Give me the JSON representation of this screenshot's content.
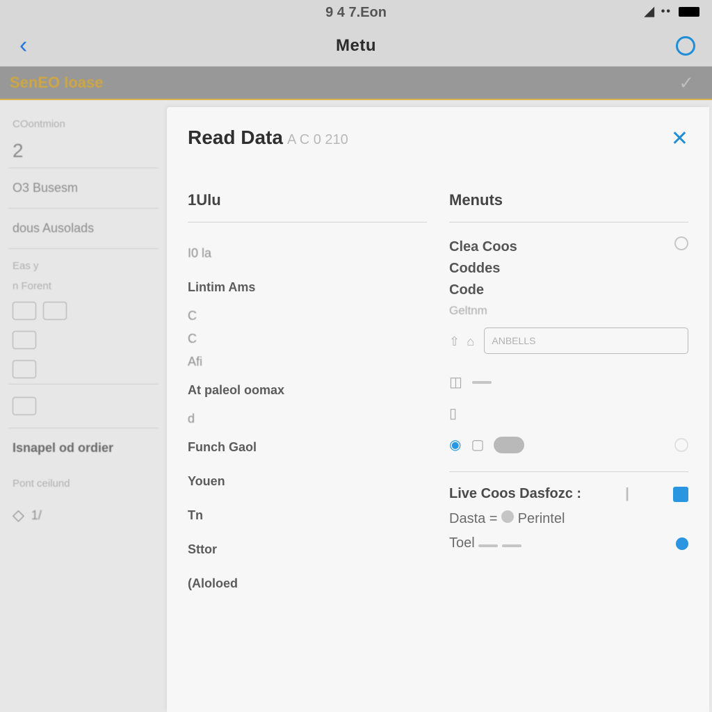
{
  "status": {
    "time": "9 4 7.Eon"
  },
  "nav": {
    "title": "Metu"
  },
  "sub": {
    "title": "SenEO loase"
  },
  "sidebar": {
    "items": [
      "COontmion",
      "2",
      "O3 Busesm",
      "dous Ausolads",
      "Eas y",
      "n Forent",
      "Isnapel od ordier",
      "Pont ceilund"
    ]
  },
  "panel": {
    "title": "Read Data",
    "subtitle": "A C 0 210",
    "left_head": "1Ulu",
    "right_head": "Menuts",
    "left_rows": [
      "I0 la",
      "Lintim Ams",
      "C",
      "C",
      "Afi",
      "At paleol oomax",
      "d",
      "Funch Gaol",
      "Youen",
      "Tn",
      "Sttor",
      "(Aloloed"
    ],
    "menu": {
      "line1": "Clea Coos",
      "line2": "Coddes",
      "line3": "Code",
      "line4": "Geltnm"
    },
    "input_placeholder": "ANBELLS",
    "live": {
      "title": "Live Coos Dasfozc :",
      "row2_a": "Dasta",
      "row2_b": "Perintel",
      "row3": "Toel"
    }
  }
}
